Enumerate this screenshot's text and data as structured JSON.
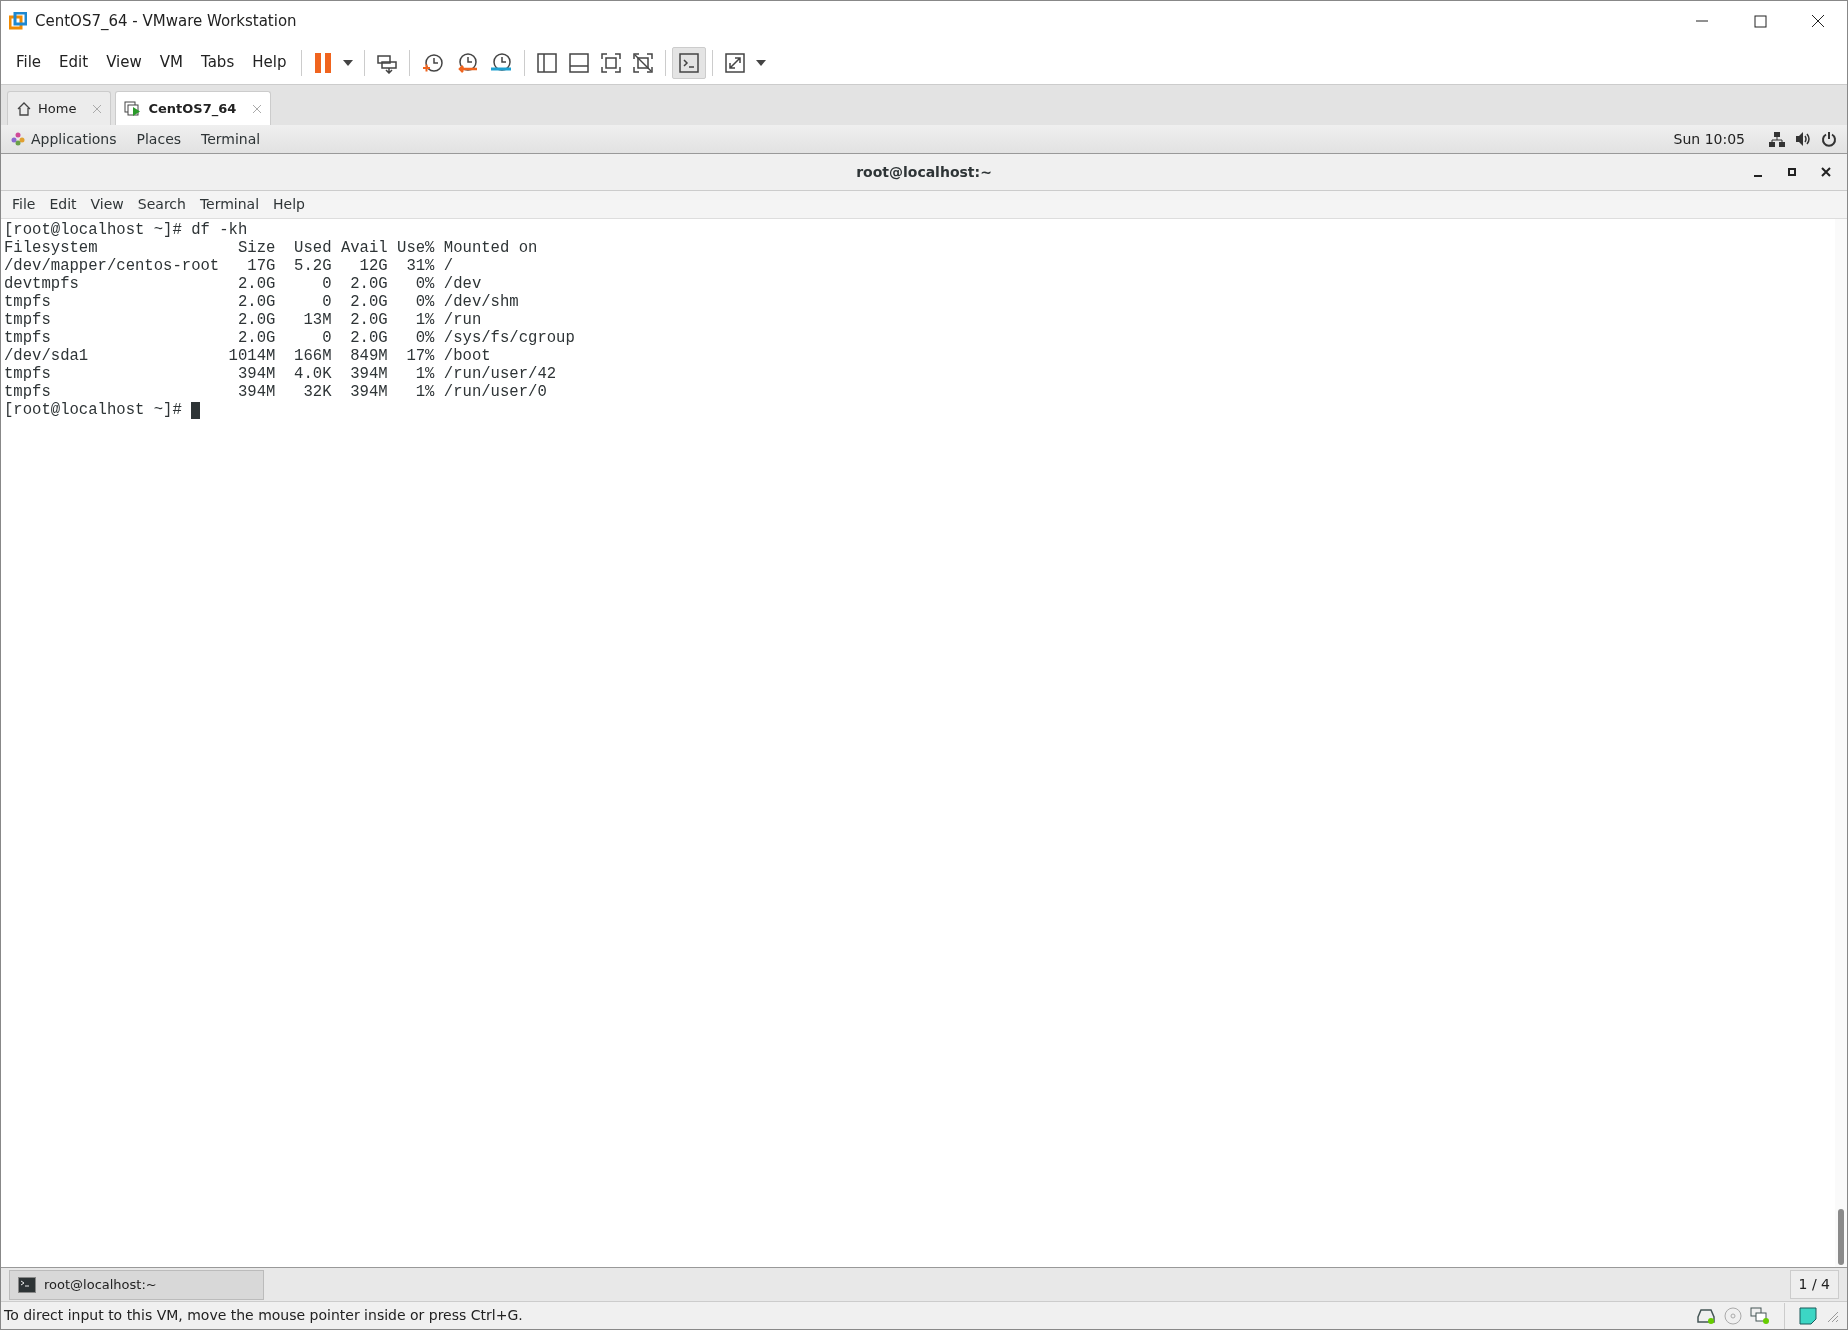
{
  "window": {
    "title": "CentOS7_64 - VMware Workstation"
  },
  "menu": [
    "File",
    "Edit",
    "View",
    "VM",
    "Tabs",
    "Help"
  ],
  "toolbar": [
    {
      "kind": "pause",
      "pressed": false
    },
    {
      "kind": "caret",
      "pressed": false
    },
    {
      "kind": "sep"
    },
    {
      "kind": "send-keys",
      "pressed": false
    },
    {
      "kind": "sep"
    },
    {
      "kind": "snap-take",
      "pressed": false
    },
    {
      "kind": "snap-revert",
      "pressed": false
    },
    {
      "kind": "snap-manage",
      "pressed": false
    },
    {
      "kind": "sep"
    },
    {
      "kind": "view-library",
      "pressed": false
    },
    {
      "kind": "view-thumb",
      "pressed": false
    },
    {
      "kind": "view-full",
      "pressed": false
    },
    {
      "kind": "view-unity",
      "pressed": false
    },
    {
      "kind": "sep"
    },
    {
      "kind": "console",
      "pressed": true
    },
    {
      "kind": "sep"
    },
    {
      "kind": "stretch",
      "pressed": false
    },
    {
      "kind": "caret",
      "pressed": false
    }
  ],
  "tabs": [
    {
      "label": "Home",
      "kind": "home",
      "selected": false
    },
    {
      "label": "CentOS7_64",
      "kind": "vm",
      "selected": true
    }
  ],
  "gnome_bar": {
    "menus": [
      "Applications",
      "Places",
      "Terminal"
    ],
    "clock": "Sun 10:05"
  },
  "terminal": {
    "title": "root@localhost:~",
    "menu": [
      "File",
      "Edit",
      "View",
      "Search",
      "Terminal",
      "Help"
    ],
    "lines": [
      "[root@localhost ~]# df -kh",
      "Filesystem               Size  Used Avail Use% Mounted on",
      "/dev/mapper/centos-root   17G  5.2G   12G  31% /",
      "devtmpfs                 2.0G     0  2.0G   0% /dev",
      "tmpfs                    2.0G     0  2.0G   0% /dev/shm",
      "tmpfs                    2.0G   13M  2.0G   1% /run",
      "tmpfs                    2.0G     0  2.0G   0% /sys/fs/cgroup",
      "/dev/sda1               1014M  166M  849M  17% /boot",
      "tmpfs                    394M  4.0K  394M   1% /run/user/42",
      "tmpfs                    394M   32K  394M   1% /run/user/0",
      "[root@localhost ~]# "
    ]
  },
  "taskbar": {
    "item": "root@localhost:~",
    "pager": "1 / 4"
  },
  "status_bar": "To direct input to this VM, move the mouse pointer inside or press Ctrl+G."
}
